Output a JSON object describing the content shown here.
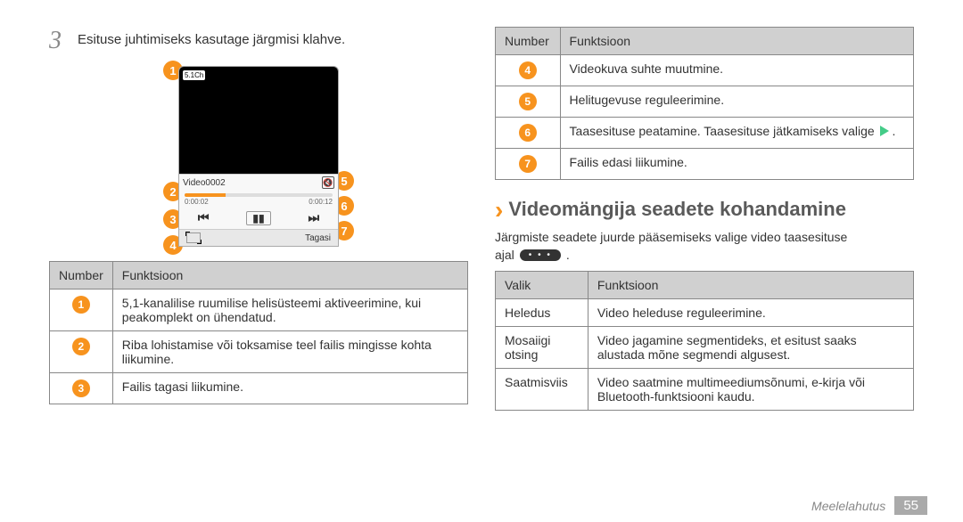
{
  "left": {
    "step_number": "3",
    "step_text": "Esituse juhtimiseks kasutage järgmisi klahve.",
    "player": {
      "badge": "5.1Ch",
      "video_name": "Video0002",
      "elapsed": "0:00:02",
      "duration": "0:00:12",
      "back_label": "Tagasi"
    },
    "table": {
      "head_num": "Number",
      "head_func": "Funktsioon",
      "rows": [
        {
          "n": "1",
          "f": "5,1-kanalilise ruumilise helisüsteemi aktiveerimine, kui peakomplekt on ühendatud."
        },
        {
          "n": "2",
          "f": "Riba lohistamise või toksamise teel failis mingisse kohta liikumine."
        },
        {
          "n": "3",
          "f": "Failis tagasi liikumine."
        }
      ]
    }
  },
  "right": {
    "table1": {
      "head_num": "Number",
      "head_func": "Funktsioon",
      "rows": [
        {
          "n": "4",
          "f": "Videokuva suhte muutmine."
        },
        {
          "n": "5",
          "f": "Helitugevuse reguleerimine."
        },
        {
          "n": "6",
          "f": "Taasesituse peatamine. Taasesituse jätkamiseks valige "
        },
        {
          "n": "7",
          "f": "Failis edasi liikumine."
        }
      ]
    },
    "heading": "Videomängija seadete kohandamine",
    "desc": "Järgmiste seadete juurde pääsemiseks valige video taasesituse",
    "ajal_text": "ajal",
    "table2": {
      "head_opt": "Valik",
      "head_func": "Funktsioon",
      "rows": [
        {
          "o": "Heledus",
          "f": "Video heleduse reguleerimine."
        },
        {
          "o": "Mosaiigi otsing",
          "f": "Video jagamine segmentideks, et esitust saaks alustada mõne segmendi algusest."
        },
        {
          "o": "Saatmisviis",
          "f": "Video saatmine multimeediumsõnumi, e-kirja või Bluetooth-funktsiooni kaudu."
        }
      ]
    }
  },
  "footer": {
    "section": "Meelelahutus",
    "page": "55"
  }
}
